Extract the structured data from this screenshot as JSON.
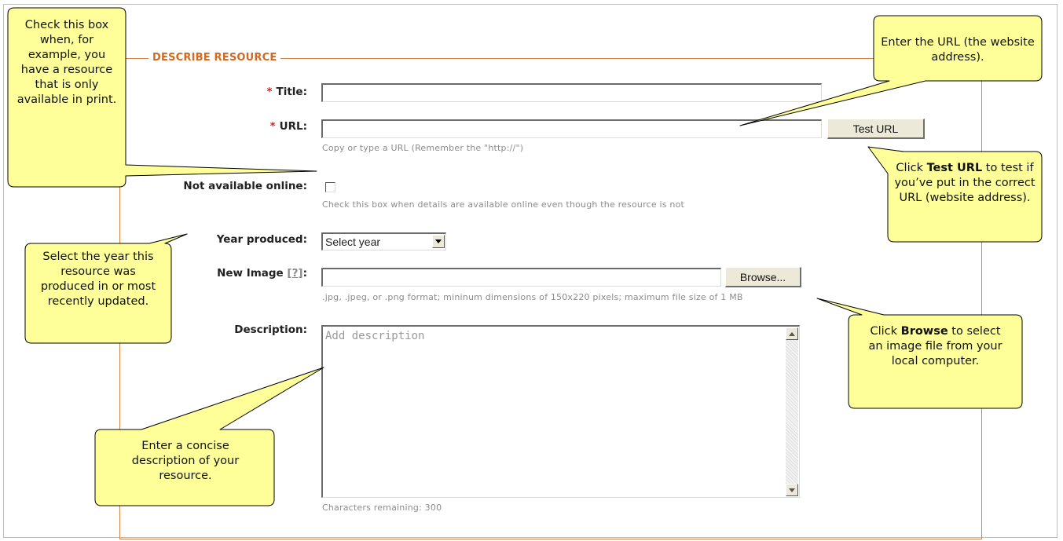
{
  "form": {
    "legend": "DESCRIBE RESOURCE",
    "required_marker": "*",
    "title_label": "Title:",
    "title_value": "",
    "url_label": "URL:",
    "url_value": "",
    "test_url_button": "Test URL",
    "url_hint": "Copy or type a URL (Remember the \"http://\")",
    "not_online_label": "Not available online:",
    "not_online_checked": false,
    "not_online_hint": "Check this box when details are available online even though the resource is not",
    "year_label": "Year produced:",
    "year_selected": "Select year",
    "image_label": "New Image",
    "image_help_link": "[?]",
    "image_colon": ":",
    "image_value": "",
    "browse_button": "Browse...",
    "image_hint": ".jpg, .jpeg, or .png format; mininum dimensions of 150x220 pixels; maximum file size of 1 MB",
    "description_label": "Description:",
    "description_placeholder": "Add description",
    "chars_remaining": "Characters remaining: 300"
  },
  "callouts": {
    "checkbox_note": "Check this box when, for example, you have a resource that is only available in print.",
    "url_note": "Enter the URL (the website address).",
    "test_url_pre": "Click ",
    "test_url_bold": "Test URL",
    "test_url_post": " to test if you’ve put in the correct URL (website address).",
    "year_note": "Select the year this resource was produced in or most recently updated.",
    "browse_pre": "Click ",
    "browse_bold": "Browse",
    "browse_post": " to select an image file from your local computer.",
    "description_note": "Enter a concise description of your resource."
  },
  "colors": {
    "accent": "#d2691e",
    "fieldset_border": "#d2864a",
    "callout_fill": "#ffff99",
    "required": "#e02020"
  },
  "icons": {
    "select_arrow": "triangle-down-icon",
    "scroll_up": "triangle-up-icon",
    "scroll_down": "triangle-down-icon"
  }
}
